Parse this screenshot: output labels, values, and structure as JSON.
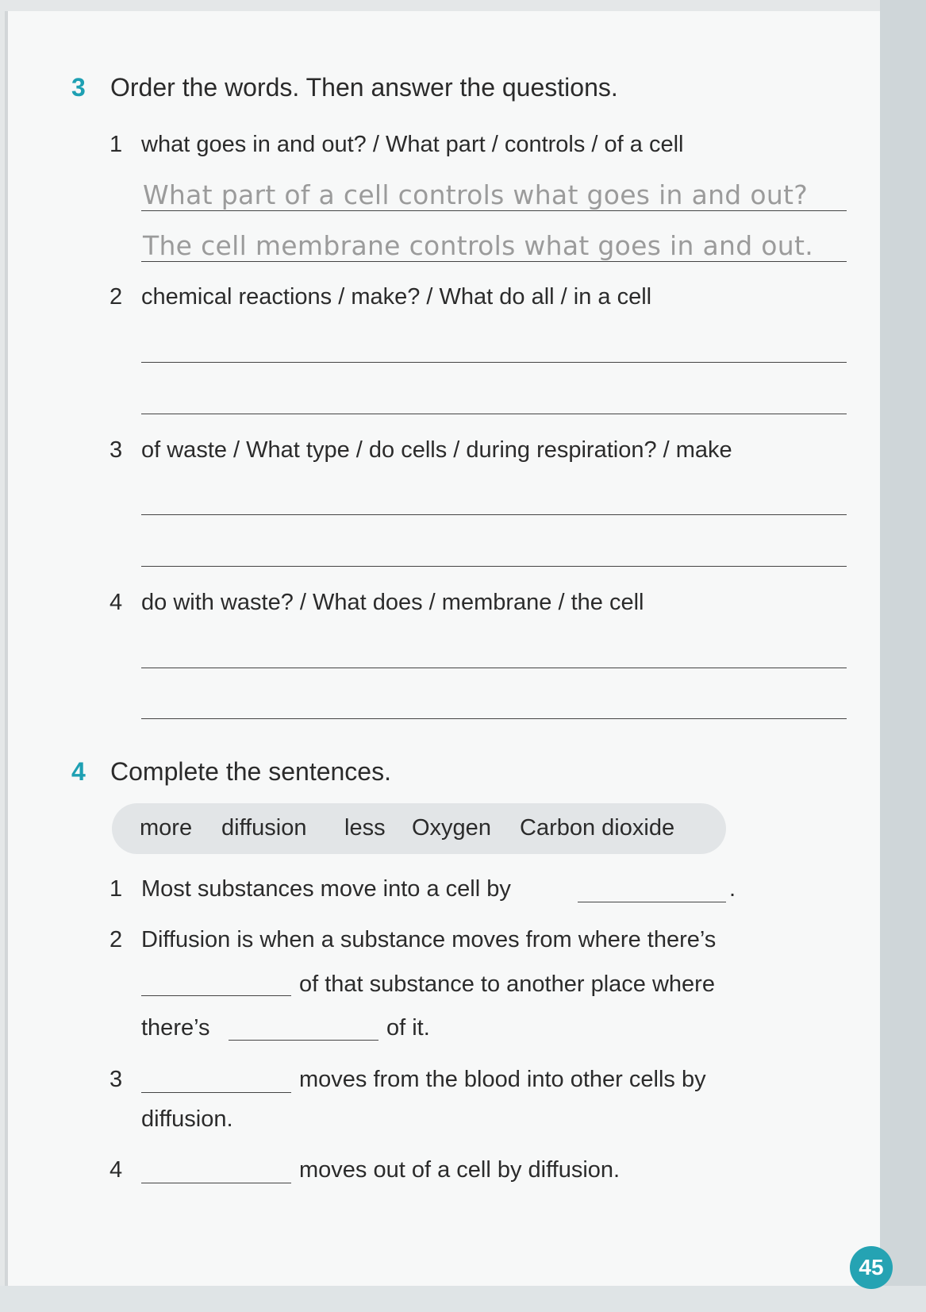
{
  "exercise3": {
    "number": "3",
    "title": "Order the words. Then answer the questions.",
    "items": [
      {
        "num": "1",
        "prompt": "what goes in and out? / What part / controls / of a cell",
        "answer_q": "What part of a cell controls what goes in and out?",
        "answer_a": "The cell membrane controls what goes in and out."
      },
      {
        "num": "2",
        "prompt": "chemical reactions / make? / What do all / in a cell"
      },
      {
        "num": "3",
        "prompt": "of waste / What type / do cells / during respiration? / make"
      },
      {
        "num": "4",
        "prompt": "do with waste? / What does / membrane / the cell"
      }
    ]
  },
  "exercise4": {
    "number": "4",
    "title": "Complete the sentences.",
    "word_bank": [
      "more",
      "diffusion",
      "less",
      "Oxygen",
      "Carbon dioxide"
    ],
    "items": [
      {
        "num": "1",
        "text_before": "Most substances move into a cell by",
        "text_end": "."
      },
      {
        "num": "2",
        "line1": "Diffusion is when a substance moves from where there’s",
        "line2": "of that substance to another place where",
        "line3a": "there’s",
        "line3b": "of it."
      },
      {
        "num": "3",
        "line1": "moves from the blood into other cells by",
        "line2": "diffusion."
      },
      {
        "num": "4",
        "line1": "moves out of a cell by diffusion."
      }
    ]
  },
  "page_number": "45"
}
